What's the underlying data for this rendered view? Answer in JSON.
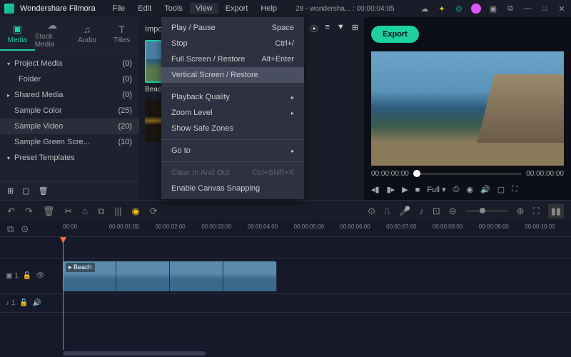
{
  "titlebar": {
    "app_name": "Wondershare Filmora",
    "project_info": "28 - wondersha... : 00:00:04:05"
  },
  "menubar": [
    "File",
    "Edit",
    "Tools",
    "View",
    "Export",
    "Help"
  ],
  "dropdown": {
    "items": [
      {
        "label": "Play / Pause",
        "shortcut": "Space"
      },
      {
        "label": "Stop",
        "shortcut": "Ctrl+/"
      },
      {
        "label": "Full Screen / Restore",
        "shortcut": "Alt+Enter"
      },
      {
        "label": "Vertical Screen / Restore",
        "shortcut": "",
        "hl": true
      },
      {
        "sep": true
      },
      {
        "label": "Playback Quality",
        "arrow": true
      },
      {
        "label": "Zoom Level",
        "arrow": true
      },
      {
        "label": "Show Safe Zones"
      },
      {
        "sep": true
      },
      {
        "label": "Go to",
        "arrow": true
      },
      {
        "sep": true
      },
      {
        "label": "Clear In And Out",
        "shortcut": "Ctrl+Shift+X",
        "disabled": true
      },
      {
        "label": "Enable Canvas Snapping"
      }
    ]
  },
  "tabs": [
    {
      "label": "Media",
      "icon": "▣"
    },
    {
      "label": "Stock Media",
      "icon": "☁"
    },
    {
      "label": "Audio",
      "icon": "♫"
    },
    {
      "label": "Titles",
      "icon": "T"
    }
  ],
  "tree": [
    {
      "label": "Project Media",
      "count": "(0)",
      "arrow": "▾"
    },
    {
      "label": "Folder",
      "count": "(0)",
      "indent": true
    },
    {
      "label": "Shared Media",
      "count": "(0)",
      "arrow": "▸"
    },
    {
      "label": "Sample Color",
      "count": "(25)"
    },
    {
      "label": "Sample Video",
      "count": "(20)",
      "sel": true
    },
    {
      "label": "Sample Green Scre...",
      "count": "(10)"
    },
    {
      "label": "Preset Templates",
      "arrow": "▾"
    }
  ],
  "center": {
    "import": "Import",
    "thumb1": "Beach"
  },
  "export_label": "Export",
  "playbar": {
    "t1": "00:00:00:00",
    "t2": "00:00:00:00"
  },
  "controls": {
    "full": "Full"
  },
  "ruler": [
    "00:00",
    "00:00:01:00",
    "00:00:02:00",
    "00:00:03:00",
    "00:00:04:00",
    "00:00:05:00",
    "00:00:06:00",
    "00:00:07:00",
    "00:00:08:00",
    "00:00:09:00",
    "00:00:10:00"
  ],
  "clip_label": "Beach",
  "track_v": "▣ 1",
  "track_a": "♪ 1"
}
